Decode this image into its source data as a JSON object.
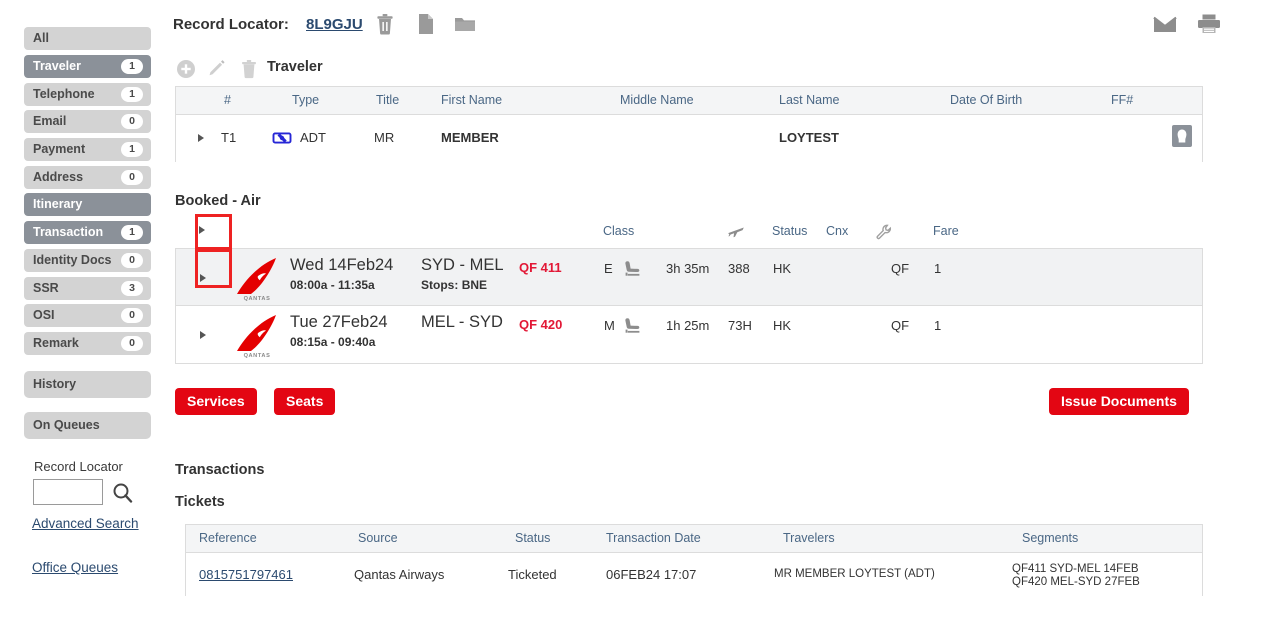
{
  "sidebar": {
    "items": [
      {
        "label": "All",
        "count": null,
        "active": false
      },
      {
        "label": "Traveler",
        "count": "1",
        "active": true
      },
      {
        "label": "Telephone",
        "count": "1",
        "active": false
      },
      {
        "label": "Email",
        "count": "0",
        "active": false
      },
      {
        "label": "Payment",
        "count": "1",
        "active": false
      },
      {
        "label": "Address",
        "count": "0",
        "active": false
      },
      {
        "label": "Itinerary",
        "count": null,
        "active": true
      },
      {
        "label": "Transaction",
        "count": "1",
        "active": true
      },
      {
        "label": "Identity Docs",
        "count": "0",
        "active": false
      },
      {
        "label": "SSR",
        "count": "3",
        "active": false
      },
      {
        "label": "OSI",
        "count": "0",
        "active": false
      },
      {
        "label": "Remark",
        "count": "0",
        "active": false
      }
    ],
    "history_label": "History",
    "on_queues_label": "On Queues",
    "record_locator_label": "Record Locator",
    "record_locator_value": "",
    "advanced_search_label": "Advanced Search",
    "office_queues_label": "Office Queues"
  },
  "header": {
    "record_locator_label": "Record Locator:",
    "record_locator_value": "8L9GJU",
    "icons": [
      "trash-icon",
      "document-icon",
      "folder-icon"
    ],
    "right_icons": [
      "email-icon",
      "print-icon"
    ]
  },
  "traveler": {
    "section_title": "Traveler",
    "toolbar": [
      "add-icon",
      "edit-icon",
      "delete-icon"
    ],
    "columns": [
      "#",
      "Type",
      "Title",
      "First Name",
      "Middle Name",
      "Last Name",
      "Date Of Birth",
      "FF#"
    ],
    "rows": [
      {
        "num": "T1",
        "type": "ADT",
        "title": "MR",
        "first_name": "MEMBER",
        "middle_name": "",
        "last_name": "LOYTEST",
        "dob": "",
        "ff": ""
      }
    ]
  },
  "booked_air": {
    "section_title": "Booked - Air",
    "columns": {
      "class": "Class",
      "plane": "plane-icon",
      "status": "Status",
      "cnx": "Cnx",
      "link": "wrench-icon",
      "fare": "Fare"
    },
    "flights": [
      {
        "carrier": "QANTAS",
        "date": "Wed 14Feb24",
        "times": "08:00a - 11:35a",
        "route": "SYD - MEL",
        "stops_label": "Stops:",
        "stops": "BNE",
        "flight_no": "QF 411",
        "class": "E",
        "duration": "3h 35m",
        "equipment": "388",
        "status": "HK",
        "cnx": "",
        "fare": "QF",
        "pax": "1"
      },
      {
        "carrier": "QANTAS",
        "date": "Tue 27Feb24",
        "times": "08:15a - 09:40a",
        "route": "MEL - SYD",
        "stops_label": "",
        "stops": "",
        "flight_no": "QF 420",
        "class": "M",
        "duration": "1h 25m",
        "equipment": "73H",
        "status": "HK",
        "cnx": "",
        "fare": "QF",
        "pax": "1"
      }
    ]
  },
  "actions": {
    "services_label": "Services",
    "seats_label": "Seats",
    "issue_documents_label": "Issue Documents",
    "button_color": "#e30613"
  },
  "transactions": {
    "section_title": "Transactions",
    "tickets_title": "Tickets",
    "columns": [
      "Reference",
      "Source",
      "Status",
      "Transaction Date",
      "Travelers",
      "Segments"
    ],
    "rows": [
      {
        "reference": "0815751797461",
        "source": "Qantas Airways",
        "status": "Ticketed",
        "transaction_date": "06FEB24 17:07",
        "travelers": "MR MEMBER LOYTEST (ADT)",
        "segment_1": "QF411 SYD-MEL 14FEB",
        "segment_2": "QF420 MEL-SYD 27FEB"
      }
    ]
  },
  "highlight": {
    "color": "#ee2222",
    "count": 2
  }
}
